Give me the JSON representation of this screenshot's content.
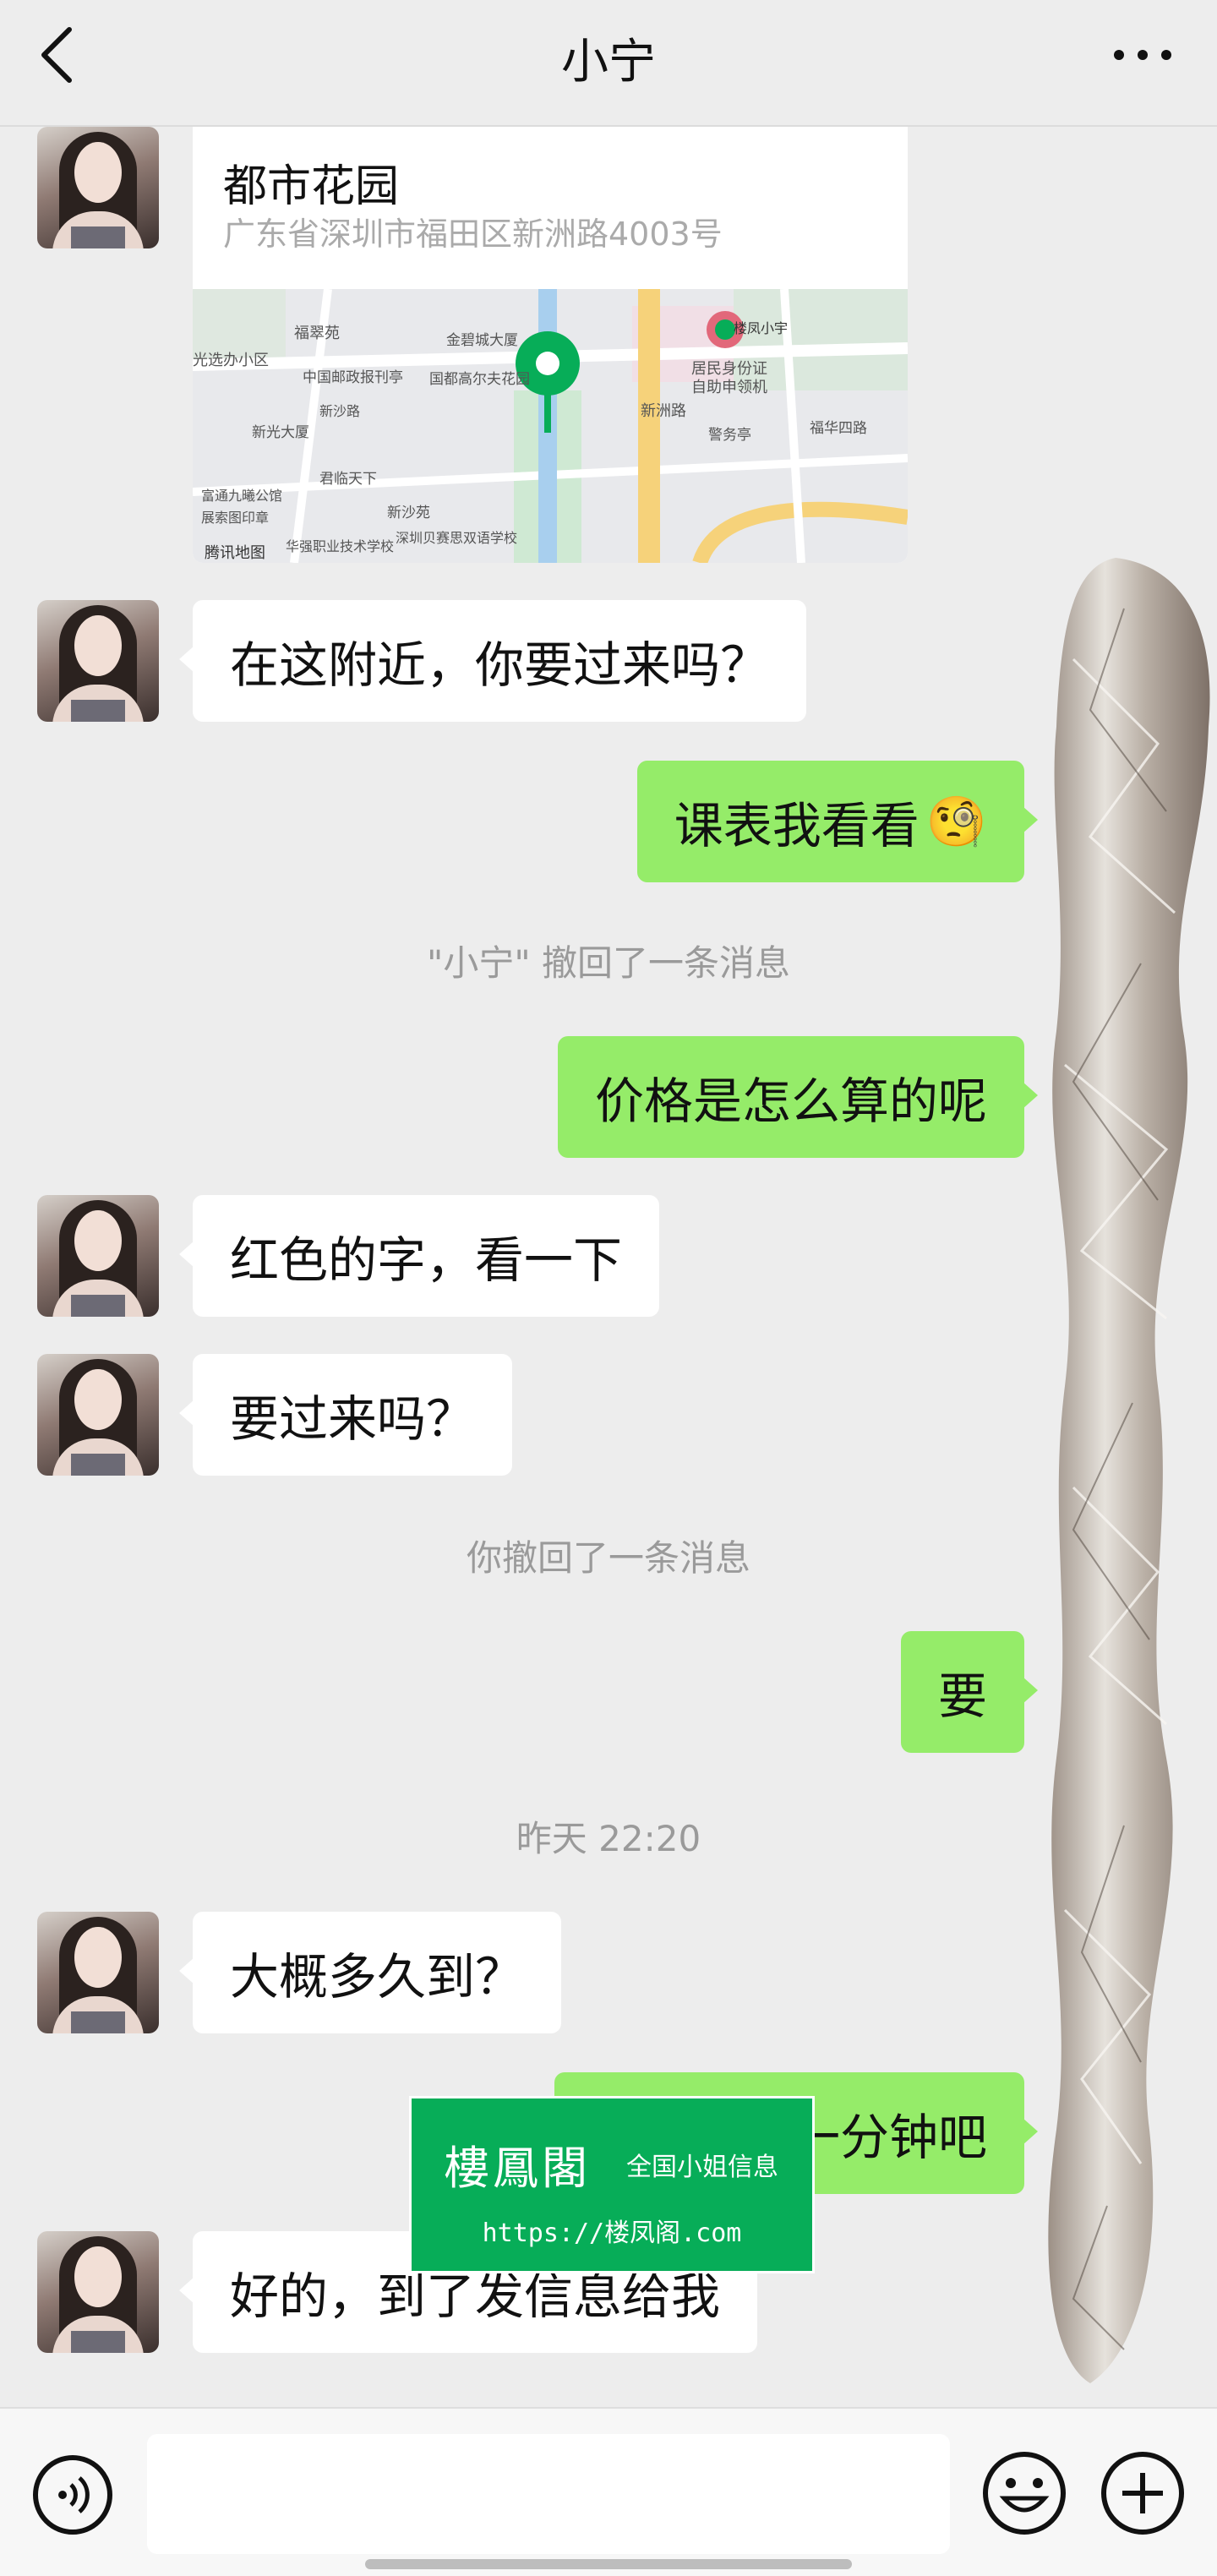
{
  "header": {
    "title": "小宁"
  },
  "location": {
    "name": "都市花园",
    "address": "广东省深圳市福田区新洲路4003号",
    "map_labels": [
      "福翠苑",
      "光选办小区",
      "中国邮政报刊亭",
      "国都高尔夫花园",
      "金碧城大厦",
      "新沙路",
      "新光大厦",
      "君临天下",
      "居民身份证",
      "自助申领机",
      "新洲路",
      "警务亭",
      "福华四路",
      "新沙苑",
      "富通九曦公馆",
      "展索图印章",
      "华强职业技术学校",
      "深圳贝赛思双语学校",
      "楼凤小宇",
      "腾讯地图"
    ]
  },
  "messages": [
    {
      "side": "left",
      "text": "在这附近，你要过来吗？"
    },
    {
      "side": "right",
      "text": "课表我看看",
      "emoji": "🧐"
    },
    {
      "side": "system",
      "text": "\"小宁\" 撤回了一条消息"
    },
    {
      "side": "right",
      "text": "价格是怎么算的呢"
    },
    {
      "side": "left",
      "text": "红色的字，看一下"
    },
    {
      "side": "left",
      "text": "要过来吗？"
    },
    {
      "side": "system",
      "text": "你撤回了一条消息"
    },
    {
      "side": "right",
      "text": "要"
    },
    {
      "side": "system",
      "text": "昨天 22:20"
    },
    {
      "side": "left",
      "text": "大概多久到？"
    },
    {
      "side": "right",
      "text": "一分钟吧"
    },
    {
      "side": "left",
      "text": "好的，到了发信息给我"
    }
  ],
  "watermark": {
    "brand": "樓鳳閣",
    "tag": "全国小姐信息",
    "url": "https://楼凤阁.com"
  },
  "colors": {
    "background": "#ededed",
    "bubble_right": "#95ec69",
    "bubble_left": "#ffffff",
    "watermark": "#07ad58",
    "map_pin": "#07ad58"
  },
  "icons": {
    "back": "chevron-left-icon",
    "more": "more-dots-icon",
    "voice": "voice-icon",
    "emoji": "emoji-icon",
    "plus": "plus-icon"
  }
}
